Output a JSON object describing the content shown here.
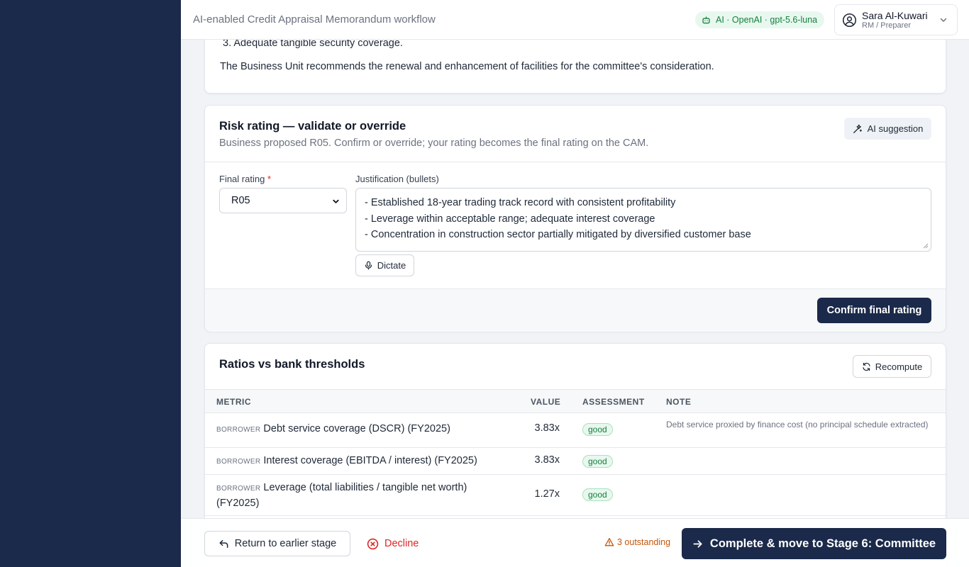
{
  "header": {
    "title": "AI-enabled Credit Appraisal Memorandum workflow",
    "ai_badge": "AI · OpenAI · gpt-5.6-luna",
    "user": {
      "name": "Sara Al-Kuwari",
      "role": "RM / Preparer"
    }
  },
  "summary": {
    "list_item": "3. Adequate tangible security coverage.",
    "recommendation": "The Business Unit recommends the renewal and enhancement of facilities for the committee's consideration."
  },
  "risk_rating": {
    "title": "Risk rating — validate or override",
    "subtitle": "Business proposed R05. Confirm or override; your rating becomes the final rating on the CAM.",
    "ai_suggestion_label": "AI suggestion",
    "final_rating_label": "Final rating",
    "required_marker": "*",
    "final_rating_value": "R05",
    "justification_label": "Justification (bullets)",
    "justification_lines": [
      "- Established 18-year trading track record with consistent profitability",
      "- Leverage within acceptable range; adequate interest coverage",
      "- Concentration in construction sector partially mitigated by diversified customer base"
    ],
    "dictate_label": "Dictate",
    "confirm_label": "Confirm final rating"
  },
  "ratios": {
    "title": "Ratios vs bank thresholds",
    "recompute_label": "Recompute",
    "columns": [
      "METRIC",
      "VALUE",
      "ASSESSMENT",
      "NOTE"
    ],
    "rows": [
      {
        "tag": "BORROWER",
        "metric": "Debt service coverage (DSCR) (FY2025)",
        "value": "3.83x",
        "assessment": "good",
        "note": "Debt service proxied by finance cost (no principal schedule extracted)"
      },
      {
        "tag": "BORROWER",
        "metric": "Interest coverage (EBITDA / interest) (FY2025)",
        "value": "3.83x",
        "assessment": "good",
        "note": ""
      },
      {
        "tag": "BORROWER",
        "metric": "Leverage (total liabilities / tangible net worth) (FY2025)",
        "value": "1.27x",
        "assessment": "good",
        "note": ""
      }
    ]
  },
  "bottom_bar": {
    "return_label": "Return to earlier stage",
    "decline_label": "Decline",
    "outstanding_label": "3 outstanding",
    "complete_label": "Complete & move to Stage 6: Committee"
  },
  "colors": {
    "sidebar": "#1b2a4a",
    "primary": "#1b2a4a",
    "success": "#15803d",
    "danger": "#dc2626",
    "warning": "#c2570c"
  }
}
